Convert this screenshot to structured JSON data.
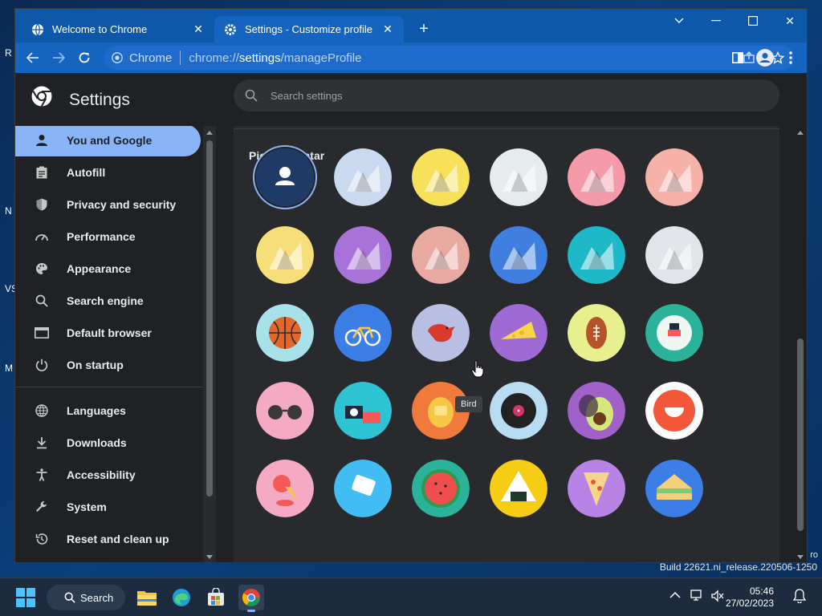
{
  "desktop": {
    "edge_labels": [
      "R",
      "N",
      "VS",
      "M"
    ],
    "build_suffix": "ro",
    "build_text": "Build 22621.ni_release.220506-1250"
  },
  "browser": {
    "tabs": [
      {
        "title": "Welcome to Chrome",
        "icon": "globe-icon",
        "active": false
      },
      {
        "title": "Settings - Customize profile",
        "icon": "gear-icon",
        "active": true
      }
    ],
    "new_tab_label": "+",
    "omnibox": {
      "site_label": "Chrome",
      "url_prefix": "chrome://",
      "url_host": "settings",
      "url_path": "/manageProfile"
    }
  },
  "settings": {
    "title": "Settings",
    "search_placeholder": "Search settings",
    "nav": [
      {
        "label": "You and Google",
        "icon": "person-icon",
        "active": true
      },
      {
        "label": "Autofill",
        "icon": "clipboard-icon",
        "active": false
      },
      {
        "label": "Privacy and security",
        "icon": "shield-icon",
        "active": false
      },
      {
        "label": "Performance",
        "icon": "speedometer-icon",
        "active": false
      },
      {
        "label": "Appearance",
        "icon": "palette-icon",
        "active": false
      },
      {
        "label": "Search engine",
        "icon": "search-icon",
        "active": false
      },
      {
        "label": "Default browser",
        "icon": "browser-icon",
        "active": false
      },
      {
        "label": "On startup",
        "icon": "power-icon",
        "active": false
      },
      {
        "label": "Languages",
        "icon": "globe-icon",
        "active": false
      },
      {
        "label": "Downloads",
        "icon": "download-icon",
        "active": false
      },
      {
        "label": "Accessibility",
        "icon": "accessibility-icon",
        "active": false
      },
      {
        "label": "System",
        "icon": "wrench-icon",
        "active": false
      },
      {
        "label": "Reset and clean up",
        "icon": "history-icon",
        "active": false
      }
    ],
    "avatar_section": {
      "heading": "Pick an avatar",
      "tooltip": "Bird",
      "avatars": [
        {
          "name": "person",
          "bg": "#1f3a66"
        },
        {
          "name": "cat",
          "bg": "#c9d9ef"
        },
        {
          "name": "corgi",
          "bg": "#f7e15a"
        },
        {
          "name": "dragon",
          "bg": "#e6ecee"
        },
        {
          "name": "elephant",
          "bg": "#f49aa8"
        },
        {
          "name": "fox",
          "bg": "#f6b1a8"
        },
        {
          "name": "monkey",
          "bg": "#f6df7a"
        },
        {
          "name": "panda",
          "bg": "#a873d9"
        },
        {
          "name": "penguin",
          "bg": "#e8a9a0"
        },
        {
          "name": "butterfly",
          "bg": "#3f7fe0"
        },
        {
          "name": "rabbit",
          "bg": "#1fb8c9"
        },
        {
          "name": "unicorn",
          "bg": "#e1e5ea"
        },
        {
          "name": "basketball",
          "bg": "#a9e1ea"
        },
        {
          "name": "bike",
          "bg": "#3b7fe6"
        },
        {
          "name": "bird",
          "bg": "#b8bfe2"
        },
        {
          "name": "cheese",
          "bg": "#9e6ad4"
        },
        {
          "name": "football",
          "bg": "#e7ef8f"
        },
        {
          "name": "sushi-plate",
          "bg": "#2ab39a"
        },
        {
          "name": "sunglasses",
          "bg": "#f4aac2"
        },
        {
          "name": "sushi",
          "bg": "#2ec3d2"
        },
        {
          "name": "tamagotchi",
          "bg": "#f07a3c"
        },
        {
          "name": "vinyl",
          "bg": "#b8dcf2"
        },
        {
          "name": "avocado",
          "bg": "#a062c9"
        },
        {
          "name": "smiley",
          "bg": "#ffffff"
        },
        {
          "name": "ice-cream",
          "bg": "#f4aac2"
        },
        {
          "name": "note",
          "bg": "#42bdf3"
        },
        {
          "name": "watermelon",
          "bg": "#2ab39a"
        },
        {
          "name": "onigiri",
          "bg": "#f6cc14"
        },
        {
          "name": "pizza",
          "bg": "#b784e6"
        },
        {
          "name": "sandwich",
          "bg": "#3b7fe6"
        }
      ]
    }
  },
  "taskbar": {
    "search_label": "Search",
    "time": "05:46",
    "date": "27/02/2023"
  }
}
